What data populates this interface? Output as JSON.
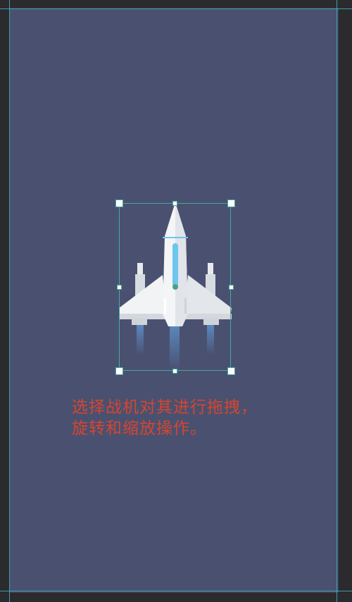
{
  "caption": {
    "line1": "选择战机对其进行拖拽，",
    "line2": "旋转和缩放操作。"
  },
  "colors": {
    "canvas_bg": "#4a5170",
    "outer_bg": "#2b2b2e",
    "guide": "#3fa9b8",
    "selection": "#46a99b",
    "caption": "#d6452f",
    "cockpit": "#6ec6ef",
    "thrust": "#5d8fc9"
  },
  "sprite": {
    "name": "fighter-plane-icon"
  }
}
